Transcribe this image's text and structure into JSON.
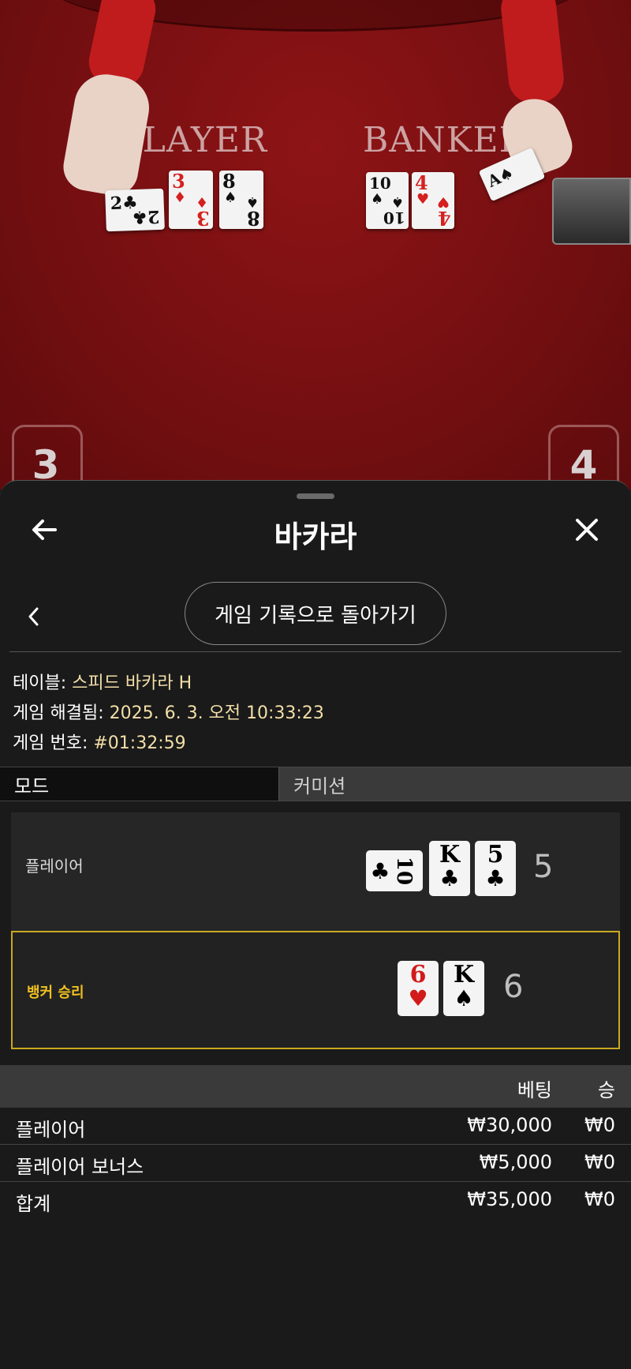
{
  "video": {
    "player_word": "PLAYER",
    "banker_word": "BANKER",
    "seat_left": "3",
    "seat_right": "4"
  },
  "sheet": {
    "title": "바카라",
    "history_button": "게임 기록으로 돌아가기"
  },
  "info": {
    "table_label": "테이블:",
    "table_value": "스피드 바카라 H",
    "resolved_label": "게임 해결됨:",
    "resolved_value": "2025. 6. 3. 오전 10:33:23",
    "number_label": "게임 번호:",
    "number_value": "#01:32:59"
  },
  "mode": {
    "mode_label": "모드",
    "commission_label": "커미션"
  },
  "result": {
    "player_label": "플레이어",
    "player_total": "5",
    "player_cards": [
      {
        "rank": "10",
        "suit": "♣",
        "color": "black",
        "orientation": "sideways"
      },
      {
        "rank": "K",
        "suit": "♣",
        "color": "black"
      },
      {
        "rank": "5",
        "suit": "♣",
        "color": "black"
      }
    ],
    "banker_label": "뱅커 승리",
    "banker_total": "6",
    "banker_cards": [
      {
        "rank": "6",
        "suit": "♥",
        "color": "red"
      },
      {
        "rank": "K",
        "suit": "♠",
        "color": "black"
      }
    ],
    "winner_highlight": "#c9a820"
  },
  "bets": {
    "col_bet": "베팅",
    "col_win": "승",
    "rows": [
      {
        "name": "플레이어",
        "amount": "₩30,000",
        "win": "₩0"
      },
      {
        "name": "플레이어 보너스",
        "amount": "₩5,000",
        "win": "₩0"
      },
      {
        "name": "합계",
        "amount": "₩35,000",
        "win": "₩0"
      }
    ]
  }
}
